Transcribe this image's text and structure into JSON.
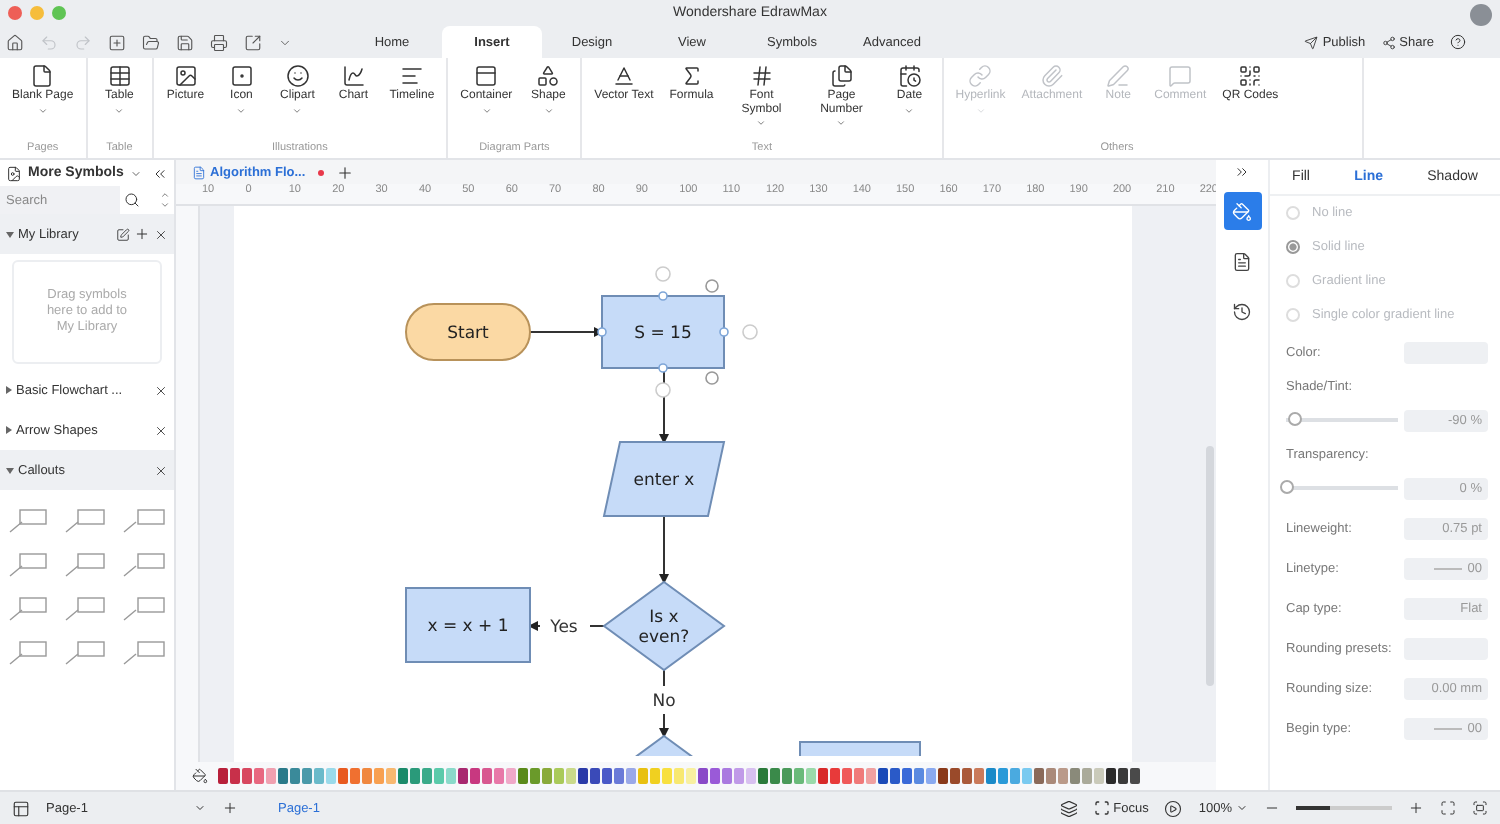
{
  "window": {
    "title": "Wondershare EdrawMax"
  },
  "menu_tabs": [
    {
      "label": "Home",
      "selected": false
    },
    {
      "label": "Insert",
      "selected": true
    },
    {
      "label": "Design",
      "selected": false
    },
    {
      "label": "View",
      "selected": false
    },
    {
      "label": "Symbols",
      "selected": false
    },
    {
      "label": "Advanced",
      "selected": false
    }
  ],
  "header_actions": [
    {
      "label": "Publish"
    },
    {
      "label": "Share"
    }
  ],
  "ribbon": [
    {
      "group": "Pages",
      "items": [
        {
          "label": "Blank Page",
          "dropdown": true,
          "disabled": false
        }
      ]
    },
    {
      "group": "Table",
      "items": [
        {
          "label": "Table",
          "dropdown": true,
          "disabled": false
        }
      ]
    },
    {
      "group": "Illustrations",
      "items": [
        {
          "label": "Picture",
          "dropdown": false,
          "disabled": false
        },
        {
          "label": "Icon",
          "dropdown": true,
          "disabled": false
        },
        {
          "label": "Clipart",
          "dropdown": true,
          "disabled": false
        },
        {
          "label": "Chart",
          "dropdown": false,
          "disabled": false
        },
        {
          "label": "Timeline",
          "dropdown": false,
          "disabled": false
        }
      ]
    },
    {
      "group": "Diagram Parts",
      "items": [
        {
          "label": "Container",
          "dropdown": true,
          "disabled": false
        },
        {
          "label": "Shape",
          "dropdown": true,
          "disabled": false
        }
      ]
    },
    {
      "group": "Text",
      "items": [
        {
          "label": "Vector Text",
          "dropdown": false,
          "disabled": false
        },
        {
          "label": "Formula",
          "dropdown": false,
          "disabled": false
        },
        {
          "label": "Font Symbol",
          "dropdown": true,
          "disabled": false
        },
        {
          "label": "Page Number",
          "dropdown": true,
          "disabled": false
        },
        {
          "label": "Date",
          "dropdown": true,
          "disabled": false
        }
      ]
    },
    {
      "group": "Others",
      "items": [
        {
          "label": "Hyperlink",
          "dropdown": true,
          "disabled": true
        },
        {
          "label": "Attachment",
          "dropdown": false,
          "disabled": true
        },
        {
          "label": "Note",
          "dropdown": false,
          "disabled": true
        },
        {
          "label": "Comment",
          "dropdown": false,
          "disabled": true
        },
        {
          "label": "QR Codes",
          "dropdown": false,
          "disabled": false
        }
      ]
    }
  ],
  "symbols_panel": {
    "title": "More Symbols",
    "search": {
      "placeholder": "Search"
    },
    "libraries": [
      {
        "name": "My Library",
        "expanded": true,
        "hint": "Drag symbols here to add to My Library"
      },
      {
        "name": "Basic Flowchart ...",
        "expanded": false
      },
      {
        "name": "Arrow Shapes",
        "expanded": false
      },
      {
        "name": "Callouts",
        "expanded": true
      }
    ]
  },
  "document_tab": {
    "title": "Algorithm Flo...",
    "unsaved": true
  },
  "ruler": {
    "marks": [
      "10",
      "0",
      "10",
      "20",
      "30",
      "40",
      "50",
      "60",
      "70",
      "80",
      "90",
      "100",
      "110",
      "120",
      "130",
      "140",
      "150",
      "160",
      "170",
      "180",
      "190",
      "200",
      "210",
      "220"
    ]
  },
  "diagram": {
    "nodes": [
      {
        "kind": "terminal",
        "text": "Start",
        "selected": false
      },
      {
        "kind": "process",
        "text": "S = 15",
        "selected": true
      },
      {
        "kind": "data",
        "text": "enter x",
        "selected": false
      },
      {
        "kind": "process",
        "text": "x = x + 1",
        "selected": false
      },
      {
        "kind": "decision",
        "text": "Is x even?",
        "selected": false
      },
      {
        "kind": "decision",
        "selected": false
      },
      {
        "kind": "process",
        "selected": false
      }
    ],
    "connectors": [
      {
        "kind": "arrow"
      },
      {
        "kind": "arrow"
      },
      {
        "kind": "arrow"
      },
      {
        "kind": "arrow",
        "label": "Yes"
      },
      {
        "kind": "arrow",
        "label": "No"
      }
    ]
  },
  "palette": [
    {
      "color": "#b8203a"
    },
    {
      "color": "#c8304a"
    },
    {
      "color": "#d84860"
    },
    {
      "color": "#e86880"
    },
    {
      "color": "#f0a0b0"
    },
    {
      "color": "#2a7a8a"
    },
    {
      "color": "#3a8a9a"
    },
    {
      "color": "#4a9aaa"
    },
    {
      "color": "#6abaca"
    },
    {
      "color": "#9adaea"
    },
    {
      "color": "#e85a20"
    },
    {
      "color": "#f07030"
    },
    {
      "color": "#f08840"
    },
    {
      "color": "#f8a050"
    },
    {
      "color": "#f8b870"
    },
    {
      "color": "#1a8a6a"
    },
    {
      "color": "#2a9a7a"
    },
    {
      "color": "#3aaa8a"
    },
    {
      "color": "#5acaaa"
    },
    {
      "color": "#8adaca"
    },
    {
      "color": "#a82870"
    },
    {
      "color": "#c83880"
    },
    {
      "color": "#d85890"
    },
    {
      "color": "#e878a8"
    },
    {
      "color": "#f0a8c8"
    },
    {
      "color": "#5a8a1a"
    },
    {
      "color": "#6a9a2a"
    },
    {
      "color": "#8aaa3a"
    },
    {
      "color": "#aaca5a"
    },
    {
      "color": "#cada8a"
    },
    {
      "color": "#2a3aa8"
    },
    {
      "color": "#3a4ab8"
    },
    {
      "color": "#4a5ac8"
    },
    {
      "color": "#6a7ad8"
    },
    {
      "color": "#9aa8e8"
    },
    {
      "color": "#e8c010"
    },
    {
      "color": "#f0d020"
    },
    {
      "color": "#f8e040"
    },
    {
      "color": "#f8e870"
    },
    {
      "color": "#f8f0a0"
    },
    {
      "color": "#8a4ac8"
    },
    {
      "color": "#9a5ad8"
    },
    {
      "color": "#aa7ae0"
    },
    {
      "color": "#c09ae8"
    },
    {
      "color": "#d8c0f0"
    },
    {
      "color": "#2a7a3a"
    },
    {
      "color": "#3a8a4a"
    },
    {
      "color": "#4a9a5a"
    },
    {
      "color": "#6aba7a"
    },
    {
      "color": "#9adaaa"
    },
    {
      "color": "#d82a2a"
    },
    {
      "color": "#e83a3a"
    },
    {
      "color": "#f05a5a"
    },
    {
      "color": "#f07a7a"
    },
    {
      "color": "#f0a0a0"
    },
    {
      "color": "#1a4ab8"
    },
    {
      "color": "#2a5ac8"
    },
    {
      "color": "#3a6ad8"
    },
    {
      "color": "#5a8ae0"
    },
    {
      "color": "#8aaaf0"
    },
    {
      "color": "#8a3a1a"
    },
    {
      "color": "#9a4a2a"
    },
    {
      "color": "#aa5a3a"
    },
    {
      "color": "#ca7a5a"
    },
    {
      "color": "#1a8ac8"
    },
    {
      "color": "#2a9ad8"
    },
    {
      "color": "#4aaae0"
    },
    {
      "color": "#7acaf0"
    },
    {
      "color": "#8a6a5a"
    },
    {
      "color": "#aa8a7a"
    },
    {
      "color": "#ba9a8a"
    },
    {
      "color": "#8a8a7a"
    },
    {
      "color": "#aaaa9a"
    },
    {
      "color": "#cacaba"
    },
    {
      "color": "#2a2a2a"
    },
    {
      "color": "#3a3a3a"
    },
    {
      "color": "#4a4a4a"
    }
  ],
  "side_tools": [
    {
      "selected": true
    },
    {
      "selected": false
    },
    {
      "selected": false
    }
  ],
  "properties": {
    "tabs": [
      {
        "label": "Fill",
        "selected": false
      },
      {
        "label": "Line",
        "selected": true
      },
      {
        "label": "Shadow",
        "selected": false
      }
    ],
    "line_options": [
      {
        "label": "No line",
        "selected": false,
        "disabled": true
      },
      {
        "label": "Solid line",
        "selected": true,
        "disabled": true
      },
      {
        "label": "Gradient line",
        "selected": false,
        "disabled": true
      },
      {
        "label": "Single color gradient line",
        "selected": false,
        "disabled": true
      }
    ],
    "fields": [
      {
        "kind": "color",
        "label": "Color:"
      },
      {
        "kind": "slider",
        "label": "Shade/Tint:",
        "level": 0.08,
        "value": "-90 %"
      },
      {
        "kind": "slider",
        "label": "Transparency:",
        "level": 0,
        "value": "0 %"
      },
      {
        "kind": "spin",
        "label": "Lineweight:",
        "value": "0.75 pt"
      },
      {
        "kind": "linetype",
        "label": "Linetype:",
        "value": "00"
      },
      {
        "kind": "select",
        "label": "Cap type:",
        "value": "Flat"
      },
      {
        "kind": "presets",
        "label": "Rounding presets:"
      },
      {
        "kind": "spin",
        "label": "Rounding size:",
        "value": "0.00 mm"
      },
      {
        "kind": "linetype",
        "label": "Begin type:",
        "value": "00"
      }
    ]
  },
  "status_bar": {
    "page_select": "Page-1",
    "pages": [
      {
        "label": "Page-1",
        "selected": true
      }
    ],
    "focus": "Focus",
    "zoom": "100%",
    "zoom_slider": {
      "level": 0.35
    }
  }
}
